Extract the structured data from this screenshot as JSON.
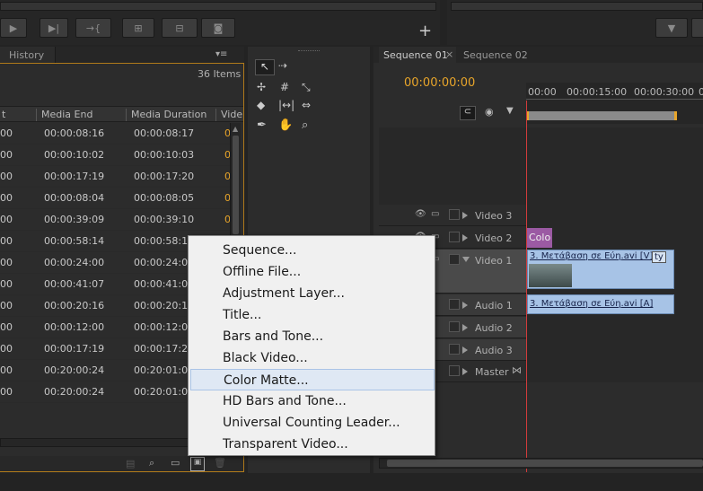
{
  "toolbar": {
    "add_label": "+"
  },
  "project": {
    "tab_history": "History",
    "item_count": "36 Items",
    "columns": [
      "t",
      "Media End",
      "Media Duration",
      "Vide"
    ],
    "rows": [
      {
        "a": "00",
        "end": "00:00:08:16",
        "dur": "00:00:08:17",
        "v": "0"
      },
      {
        "a": "00",
        "end": "00:00:10:02",
        "dur": "00:00:10:03",
        "v": "0"
      },
      {
        "a": "00",
        "end": "00:00:17:19",
        "dur": "00:00:17:20",
        "v": "0"
      },
      {
        "a": "00",
        "end": "00:00:08:04",
        "dur": "00:00:08:05",
        "v": "0"
      },
      {
        "a": "00",
        "end": "00:00:39:09",
        "dur": "00:00:39:10",
        "v": "0"
      },
      {
        "a": "00",
        "end": "00:00:58:14",
        "dur": "00:00:58:15",
        "v": ""
      },
      {
        "a": "00",
        "end": "00:00:24:00",
        "dur": "00:00:24:01",
        "v": ""
      },
      {
        "a": "00",
        "end": "00:00:41:07",
        "dur": "00:00:41:08",
        "v": ""
      },
      {
        "a": "00",
        "end": "00:00:20:16",
        "dur": "00:00:20:17",
        "v": ""
      },
      {
        "a": "00",
        "end": "00:00:12:00",
        "dur": "00:00:12:01",
        "v": ""
      },
      {
        "a": "00",
        "end": "00:00:17:19",
        "dur": "00:00:17:20",
        "v": ""
      },
      {
        "a": "00",
        "end": "00:20:00:24",
        "dur": "00:20:01:00",
        "v": ""
      },
      {
        "a": "00",
        "end": "00:20:00:24",
        "dur": "00:20:01:00",
        "v": ""
      }
    ]
  },
  "sequence": {
    "tabs": [
      "Sequence 01",
      "Sequence 02"
    ],
    "tab_close": "×",
    "timecode": "00:00:00:00",
    "ruler": [
      "00:00",
      "00:00:15:00",
      "00:00:30:00",
      "0"
    ],
    "tracks": [
      {
        "name": "Video 3"
      },
      {
        "name": "Video 2"
      },
      {
        "name": "Video 1"
      },
      {
        "name": "Audio 1"
      },
      {
        "name": "Audio 2"
      },
      {
        "name": "Audio 3"
      },
      {
        "name": "Master"
      }
    ],
    "clips": {
      "color_label": "Colo",
      "video_label": "3. Μετάβαση σε Εύη.avi [V]",
      "video_tag": "ty",
      "audio_label": "3. Μετάβαση σε Εύη.avi [A]"
    }
  },
  "context_menu": {
    "items": [
      "Sequence...",
      "Offline File...",
      "Adjustment Layer...",
      "Title...",
      "Bars and Tone...",
      "Black Video...",
      "Color Matte...",
      "HD Bars and Tone...",
      "Universal Counting Leader...",
      "Transparent Video..."
    ],
    "highlighted_index": 6
  },
  "colors": {
    "accent": "#e8a52a",
    "playhead": "#d23b3b",
    "clip_video": "#a7c3e6",
    "clip_color": "#9b5aa3"
  }
}
